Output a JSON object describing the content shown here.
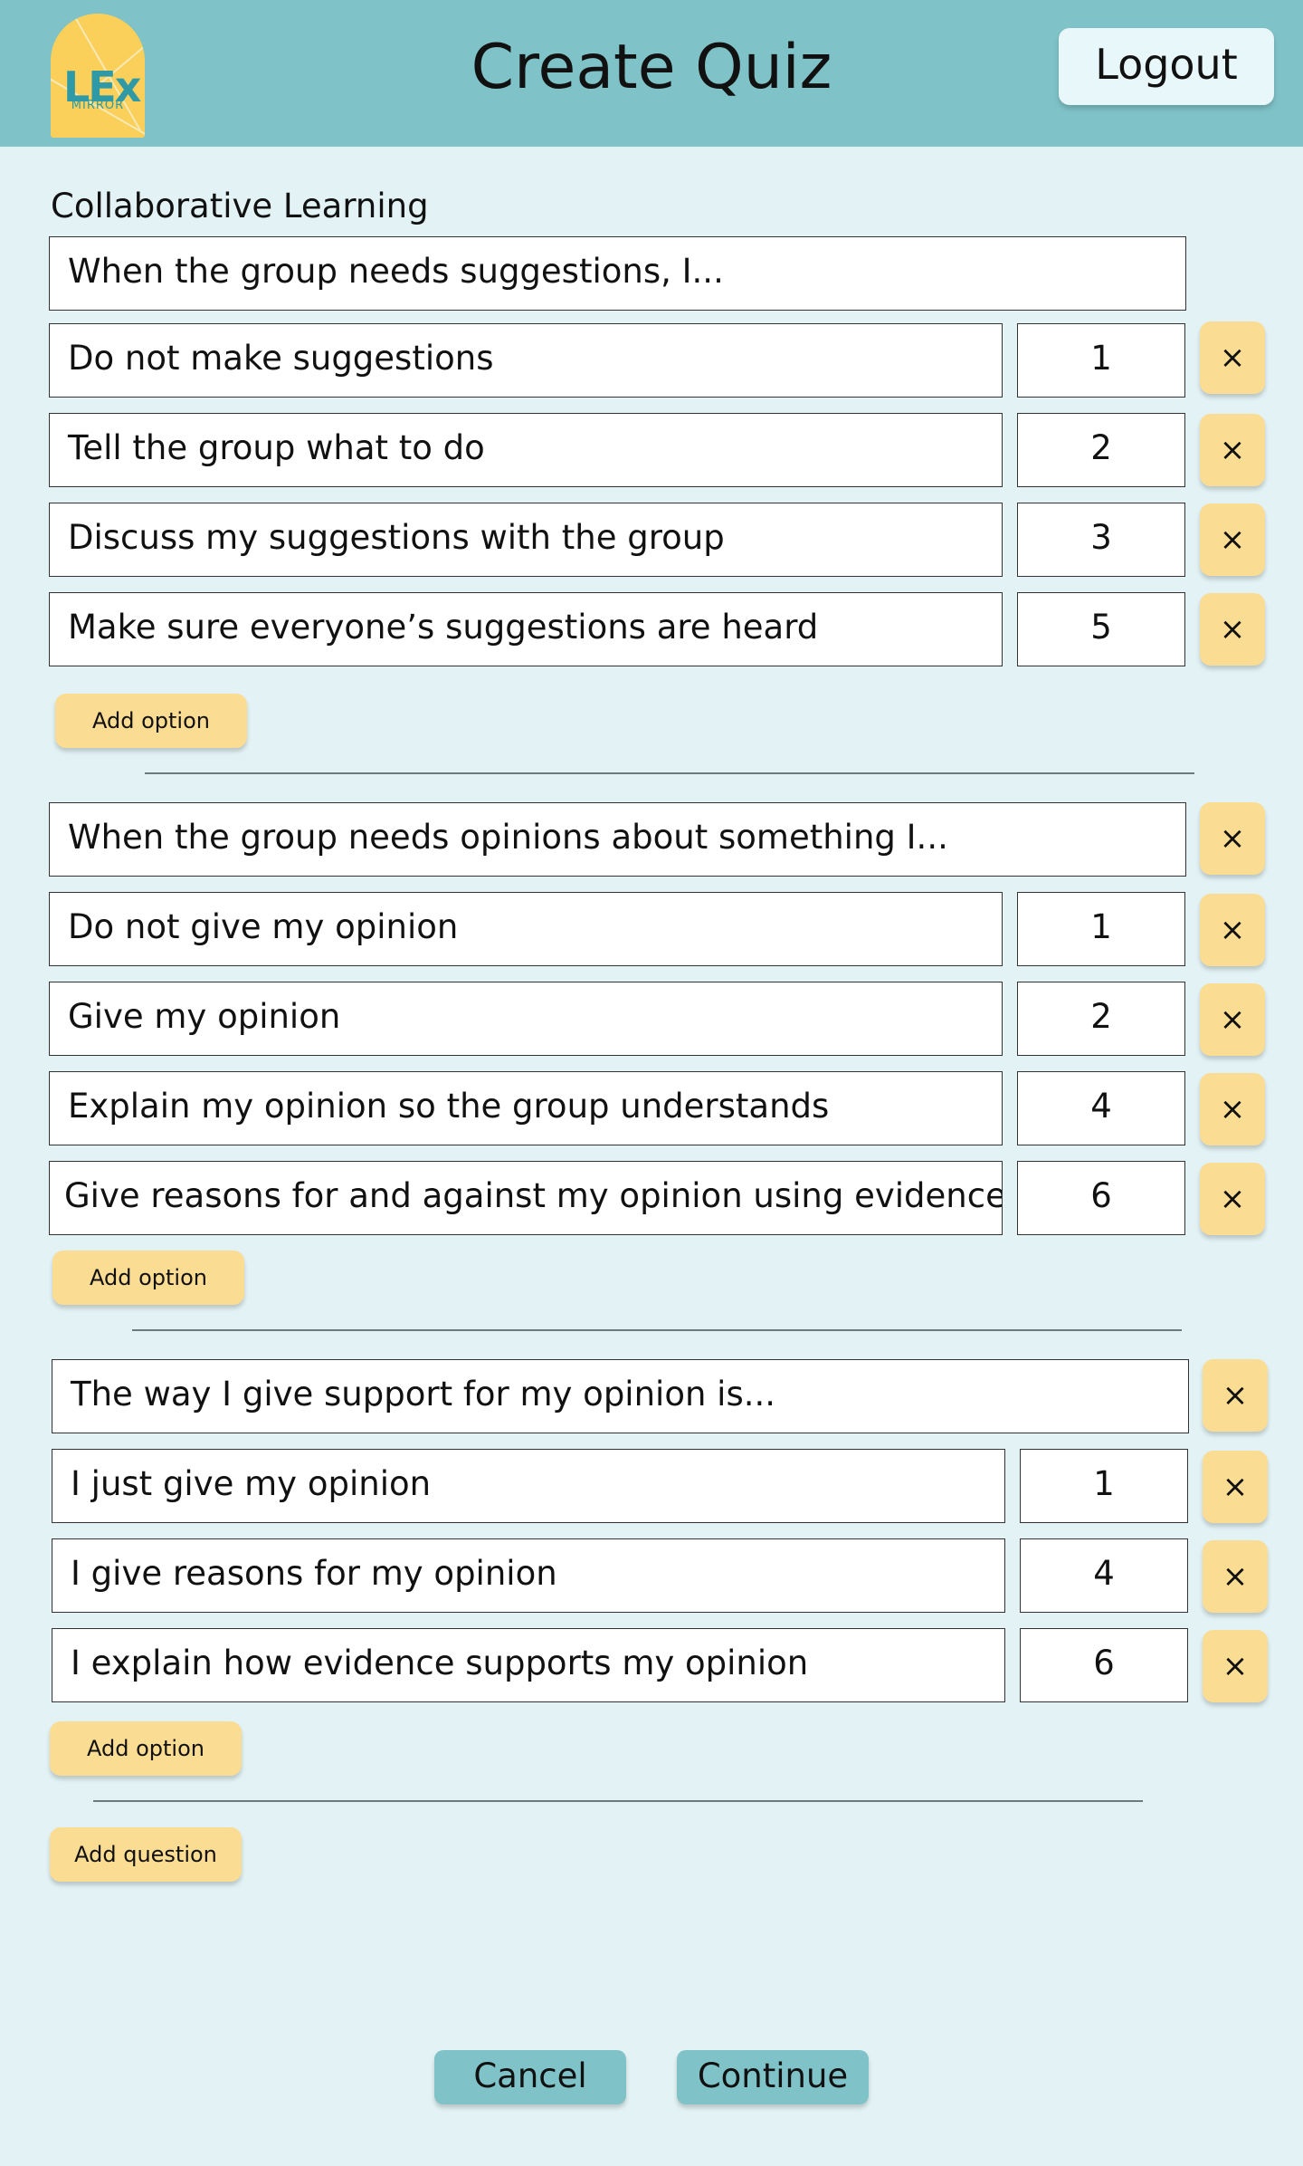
{
  "header": {
    "logo_text": "LEx",
    "logo_subtext": "MIRROR",
    "title": "Create Quiz",
    "logout_label": "Logout"
  },
  "section_title": "Collaborative Learning",
  "questions": [
    {
      "text": "When the group needs suggestions, I...",
      "options": [
        {
          "text": "Do not make suggestions",
          "score": "1"
        },
        {
          "text": "Tell the group what to do",
          "score": "2"
        },
        {
          "text": "Discuss my suggestions with the group",
          "score": "3"
        },
        {
          "text": "Make sure everyone’s suggestions are heard",
          "score": "5"
        }
      ],
      "add_option_label": "Add option"
    },
    {
      "text": "When the group needs opinions about something I...",
      "options": [
        {
          "text": "Do not give my opinion",
          "score": "1"
        },
        {
          "text": "Give my opinion",
          "score": "2"
        },
        {
          "text": "Explain my opinion so the group understands",
          "score": "4"
        },
        {
          "text": "Give reasons for and against my opinion using evidence",
          "score": "6"
        }
      ],
      "add_option_label": "Add option"
    },
    {
      "text": "The way I give support for my opinion is...",
      "options": [
        {
          "text": "I just give my opinion",
          "score": "1"
        },
        {
          "text": "I give reasons for my opinion",
          "score": "4"
        },
        {
          "text": "I explain how evidence supports my opinion",
          "score": "6"
        }
      ],
      "add_option_label": "Add option"
    }
  ],
  "remove_icon_glyph": "×",
  "add_question_label": "Add question",
  "footer": {
    "cancel_label": "Cancel",
    "continue_label": "Continue"
  },
  "colors": {
    "header_bg": "#7fc3c8",
    "page_bg": "#e3f3f5",
    "accent_yellow": "#fbdc93",
    "logo_yellow": "#fbd05a",
    "logo_teal": "#2f9aa6"
  }
}
